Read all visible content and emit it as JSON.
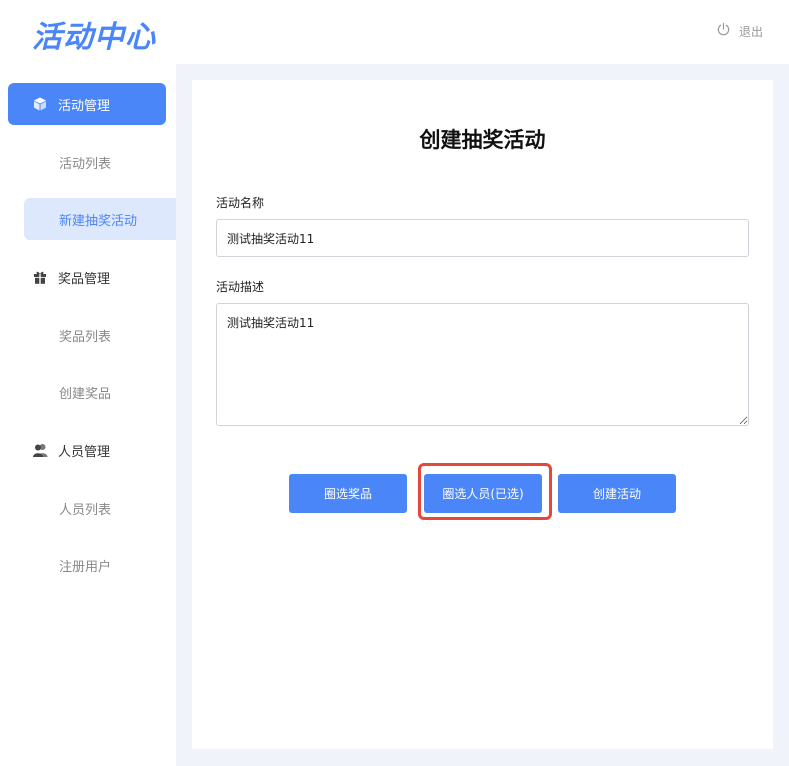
{
  "header": {
    "logo_text": "活动中心",
    "logout_label": "退出",
    "accent_color": "#4a86f7"
  },
  "sidebar": {
    "groups": [
      {
        "label": "活动管理",
        "icon": "cube-icon",
        "active": true,
        "items": [
          {
            "label": "活动列表"
          },
          {
            "label": "新建抽奖活动",
            "selected": true
          }
        ]
      },
      {
        "label": "奖品管理",
        "icon": "gift-icon",
        "items": [
          {
            "label": "奖品列表"
          },
          {
            "label": "创建奖品"
          }
        ]
      },
      {
        "label": "人员管理",
        "icon": "users-icon",
        "items": [
          {
            "label": "人员列表"
          },
          {
            "label": "注册用户"
          }
        ]
      }
    ]
  },
  "form": {
    "title": "创建抽奖活动",
    "name_label": "活动名称",
    "name_value": "测试抽奖活动11",
    "desc_label": "活动描述",
    "desc_value": "测试抽奖活动11"
  },
  "buttons": {
    "select_prizes": "圈选奖品",
    "select_people": "圈选人员(已选)",
    "create_activity": "创建活动"
  },
  "highlight_color": "#e5483a"
}
